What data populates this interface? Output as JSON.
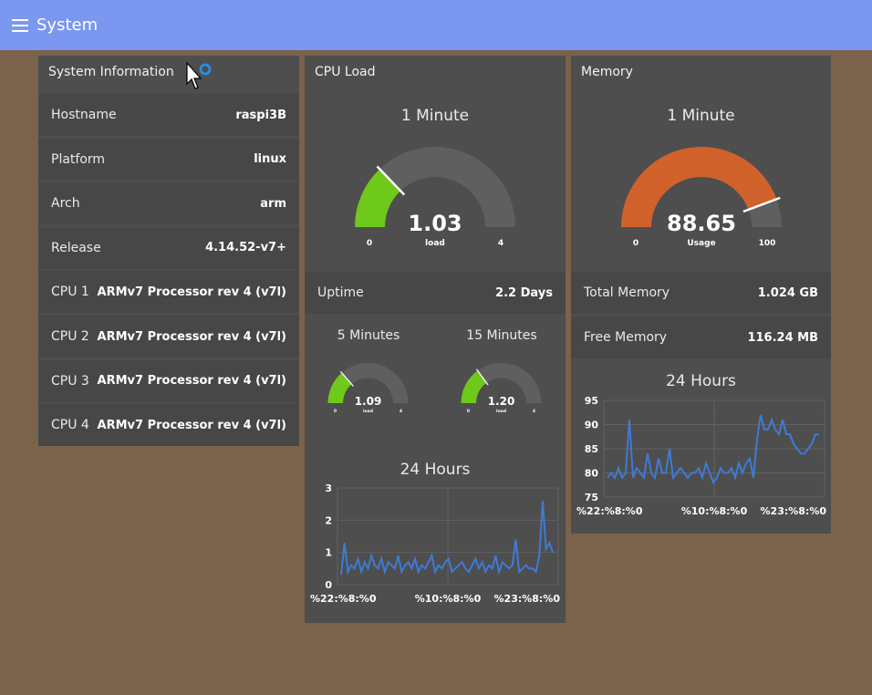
{
  "header": {
    "title": "System",
    "menu_icon": "hamburger-icon"
  },
  "sysinfo": {
    "title": "System Information",
    "rows": [
      {
        "label": "Hostname",
        "value": "raspi3B"
      },
      {
        "label": "Platform",
        "value": "linux"
      },
      {
        "label": "Arch",
        "value": "arm"
      },
      {
        "label": "Release",
        "value": "4.14.52-v7+"
      },
      {
        "label": "CPU 1",
        "value": "ARMv7 Processor rev 4 (v7l)"
      },
      {
        "label": "CPU 2",
        "value": "ARMv7 Processor rev 4 (v7l)"
      },
      {
        "label": "CPU 3",
        "value": "ARMv7 Processor rev 4 (v7l)"
      },
      {
        "label": "CPU 4",
        "value": "ARMv7 Processor rev 4 (v7l)"
      }
    ]
  },
  "cpu": {
    "title": "CPU Load",
    "gauge1": {
      "heading": "1 Minute",
      "value": "1.03",
      "unit": "load",
      "min": "0",
      "max": "4",
      "fraction": 0.2575,
      "color": "#6ec91a"
    },
    "uptime": {
      "label": "Uptime",
      "value": "2.2 Days"
    },
    "gauge5": {
      "heading": "5 Minutes",
      "value": "1.09",
      "unit": "load",
      "min": "0",
      "max": "4",
      "fraction": 0.2725,
      "color": "#6ec91a"
    },
    "gauge15": {
      "heading": "15 Minutes",
      "value": "1.20",
      "unit": "load",
      "min": "0",
      "max": "4",
      "fraction": 0.3,
      "color": "#6ec91a"
    },
    "chart_title": "24 Hours"
  },
  "memory": {
    "title": "Memory",
    "gauge": {
      "heading": "1 Minute",
      "value": "88.65",
      "unit": "Usage",
      "min": "0",
      "max": "100",
      "fraction": 0.8865,
      "color": "#d1622b"
    },
    "total": {
      "label": "Total Memory",
      "value": "1.024 GB"
    },
    "free": {
      "label": "Free Memory",
      "value": "116.24 MB"
    },
    "chart_title": "24 Hours"
  },
  "colors": {
    "accent": "#7b97ef",
    "background": "#7a624b",
    "panel": "#4e4e4e",
    "line": "#3e7ad6",
    "gauge_track": "#5f5f5f"
  },
  "chart_data": [
    {
      "type": "line",
      "title": "24 Hours",
      "x_tick_labels": [
        "%22:%8:%0",
        "%10:%8:%0",
        "%23:%8:%0"
      ],
      "y_ticks": [
        0,
        1,
        2,
        3
      ],
      "ylim": [
        0,
        3
      ],
      "grid": true,
      "series": [
        {
          "values": [
            0.3,
            1.3,
            0.4,
            0.6,
            0.5,
            0.8,
            0.4,
            0.7,
            0.5,
            0.9,
            0.6,
            0.5,
            0.8,
            0.4,
            0.7,
            0.6,
            0.5,
            0.9,
            0.4,
            0.6,
            0.7,
            0.5,
            0.8,
            0.4,
            0.6,
            0.5,
            0.7,
            0.9,
            0.4,
            0.6,
            0.5,
            0.7,
            0.8,
            0.4,
            0.5,
            0.6,
            0.7,
            0.5,
            0.4,
            0.6,
            0.8,
            0.5,
            0.7,
            0.4,
            0.6,
            0.5,
            0.9,
            0.4,
            0.7,
            0.6,
            0.5,
            0.6,
            1.4,
            0.4,
            0.5,
            0.6,
            0.5,
            0.5,
            0.4,
            0.9,
            2.6,
            1.1,
            1.3,
            1.0
          ]
        }
      ]
    },
    {
      "type": "line",
      "title": "24 Hours",
      "x_tick_labels": [
        "%22:%8:%0",
        "%10:%8:%0",
        "%23:%8:%0"
      ],
      "y_ticks": [
        75,
        80,
        85,
        90,
        95
      ],
      "ylim": [
        75,
        95
      ],
      "grid": true,
      "series": [
        {
          "values": [
            79,
            80,
            79,
            81,
            79,
            80,
            91,
            79,
            81,
            80,
            79,
            84,
            80,
            79,
            83,
            80,
            80,
            85,
            79,
            80,
            81,
            80,
            79,
            80,
            80,
            81,
            79,
            82,
            80,
            78,
            79,
            81,
            80,
            80,
            81,
            79,
            82,
            80,
            82,
            83,
            79,
            87,
            92,
            89,
            89,
            91,
            89,
            88,
            91,
            88,
            88,
            86,
            85,
            84,
            84,
            85,
            86,
            88,
            88
          ]
        }
      ]
    }
  ]
}
